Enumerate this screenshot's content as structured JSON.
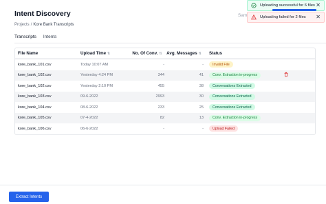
{
  "header": {
    "title": "Intent Discovery",
    "breadcrumb": {
      "root": "Projects",
      "separator": "/",
      "current": "Kore Bank Transcripts"
    },
    "sample_text": "Samp"
  },
  "tabs": [
    {
      "label": "Transcripts",
      "active": true
    },
    {
      "label": "Intents",
      "active": false
    }
  ],
  "table": {
    "columns": {
      "file_name": "File Name",
      "upload_time": "Upload Time",
      "num_conv": "No. Of Conv.",
      "avg_messages": "Avg. Messages",
      "status": "Status"
    },
    "rows": [
      {
        "file": "kore_bank_101.csv",
        "time": "Today 10:07 AM",
        "conv": "-",
        "msg": "-",
        "status": "Invalid File",
        "status_type": "invalid",
        "delete": false
      },
      {
        "file": "kore_bank_102.csv",
        "time": "Yesterday 4:24 PM",
        "conv": "344",
        "msg": "41",
        "status": "Conv. Extraction in-progress",
        "status_type": "progress",
        "delete": true
      },
      {
        "file": "kore_bank_102.csv",
        "time": "Yesterday 2:10 PM",
        "conv": "455",
        "msg": "38",
        "status": "Conversations Extracted",
        "status_type": "extracted",
        "delete": false
      },
      {
        "file": "kore_bank_103.csv",
        "time": "09-6-2022",
        "conv": "2993",
        "msg": "30",
        "status": "Conversations Extracted",
        "status_type": "extracted",
        "delete": false
      },
      {
        "file": "kore_bank_104.csv",
        "time": "08-6-2022",
        "conv": "233",
        "msg": "25",
        "status": "Conversations Extracted",
        "status_type": "extracted",
        "delete": false
      },
      {
        "file": "kore_bank_105.csv",
        "time": "07-4-2022",
        "conv": "82",
        "msg": "13",
        "status": "Conv. Extraction in-progress",
        "status_type": "progress",
        "delete": false
      },
      {
        "file": "kore_bank_106.csv",
        "time": "06-6-2022",
        "conv": "-",
        "msg": "-",
        "status": "Upload Failed",
        "status_type": "failed",
        "delete": false
      }
    ]
  },
  "footer": {
    "extract_button": "Extract Intents"
  },
  "toasts": {
    "success": {
      "message": "Uploading successful for 6 files",
      "close": "✕"
    },
    "error": {
      "message": "Uploading failed for 2 files",
      "close": "✕"
    }
  },
  "sort_glyph": "⇅",
  "colors": {
    "accent": "#2563eb",
    "danger": "#dc2626",
    "success": "#15803d",
    "warning": "#b45309"
  }
}
